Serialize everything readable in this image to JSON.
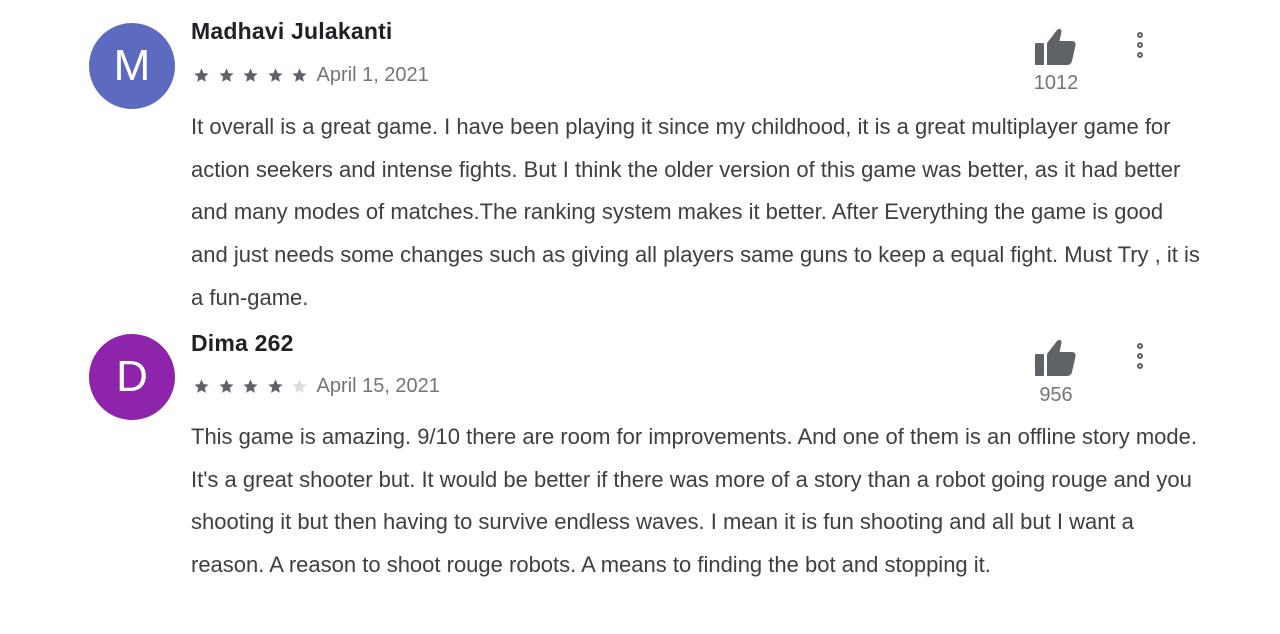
{
  "colors": {
    "star_filled": "#5f6368",
    "star_empty": "#dadce0",
    "avatar_m": "#5c6bc0",
    "avatar_d": "#8e24aa",
    "meta_text": "#757575"
  },
  "reviews": [
    {
      "avatar_letter": "M",
      "author": "Madhavi Julakanti",
      "rating": 5,
      "rating_max": 5,
      "date": "April 1, 2021",
      "helpful_icon": "thumbs-up-icon",
      "helpful_count": "1012",
      "more_icon": "more-vert-icon",
      "text": "It overall is a great game. I have been playing it since my childhood, it is a great multiplayer game for action seekers and intense fights. But I think the older version of this game was better, as it had better and many modes of matches.The ranking system makes it better. After Everything the game is good and just needs some changes such as giving all players same guns to keep a equal fight. Must Try , it is a fun-game."
    },
    {
      "avatar_letter": "D",
      "author": "Dima 262",
      "rating": 4,
      "rating_max": 5,
      "date": "April 15, 2021",
      "helpful_icon": "thumbs-up-icon",
      "helpful_count": "956",
      "more_icon": "more-vert-icon",
      "text": "This game is amazing. 9/10 there are room for improvements. And one of them is an offline story mode. It's a great shooter but. It would be better if there was more of a story than a robot going rouge and you shooting it but then having to survive endless waves. I mean it is fun shooting and all but I want a reason. A reason to shoot rouge robots. A means to finding the bot and stopping it."
    }
  ]
}
